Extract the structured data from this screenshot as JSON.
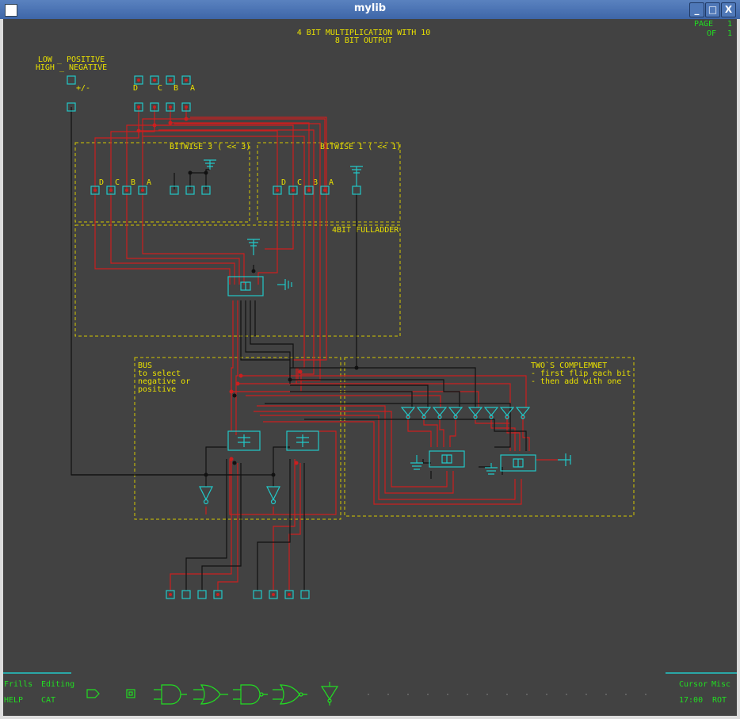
{
  "window": {
    "title": "mylib",
    "buttons": {
      "minimize": "_",
      "maximize": "□",
      "close": "X"
    }
  },
  "header": {
    "title_line1": "4 BIT MULTIPLICATION WITH 10",
    "title_line2": "8 BIT OUTPUT",
    "page_label": "PAGE",
    "page_value": "1",
    "of_label": "OF",
    "of_value": "1"
  },
  "schematic": {
    "sign_label_1": "LOW _ POSITIVE",
    "sign_label_2": "HIGH _ NEGATIVE",
    "sign_pin": "+/-",
    "input_pins": [
      "D",
      "C",
      "B",
      "A"
    ],
    "block_bitwise3": "BITWISE 3 ( << 3)",
    "block_bitwise1": "BITWISE 1 ( << 1)",
    "block_fulladder": "4BIT FULLADDER",
    "bus_lines": [
      "BUS",
      "to select",
      "negative or",
      "positive"
    ],
    "twos_lines": [
      "TWO`S COMPLEMNET",
      "- first flip each bit",
      "- then add with one"
    ]
  },
  "bottom": {
    "left_menu": [
      "Frills",
      "Editing",
      "HELP",
      "CAT"
    ],
    "right_menu": [
      "Cursor",
      "Misc",
      "17:00",
      "ROT"
    ]
  },
  "colors": {
    "canvas": "#424242",
    "wire_red": "#cc1f1f",
    "wire_black": "#111111",
    "component": "#22c8c8",
    "text_yellow": "#e8e000",
    "menu_green": "#22dd22"
  }
}
